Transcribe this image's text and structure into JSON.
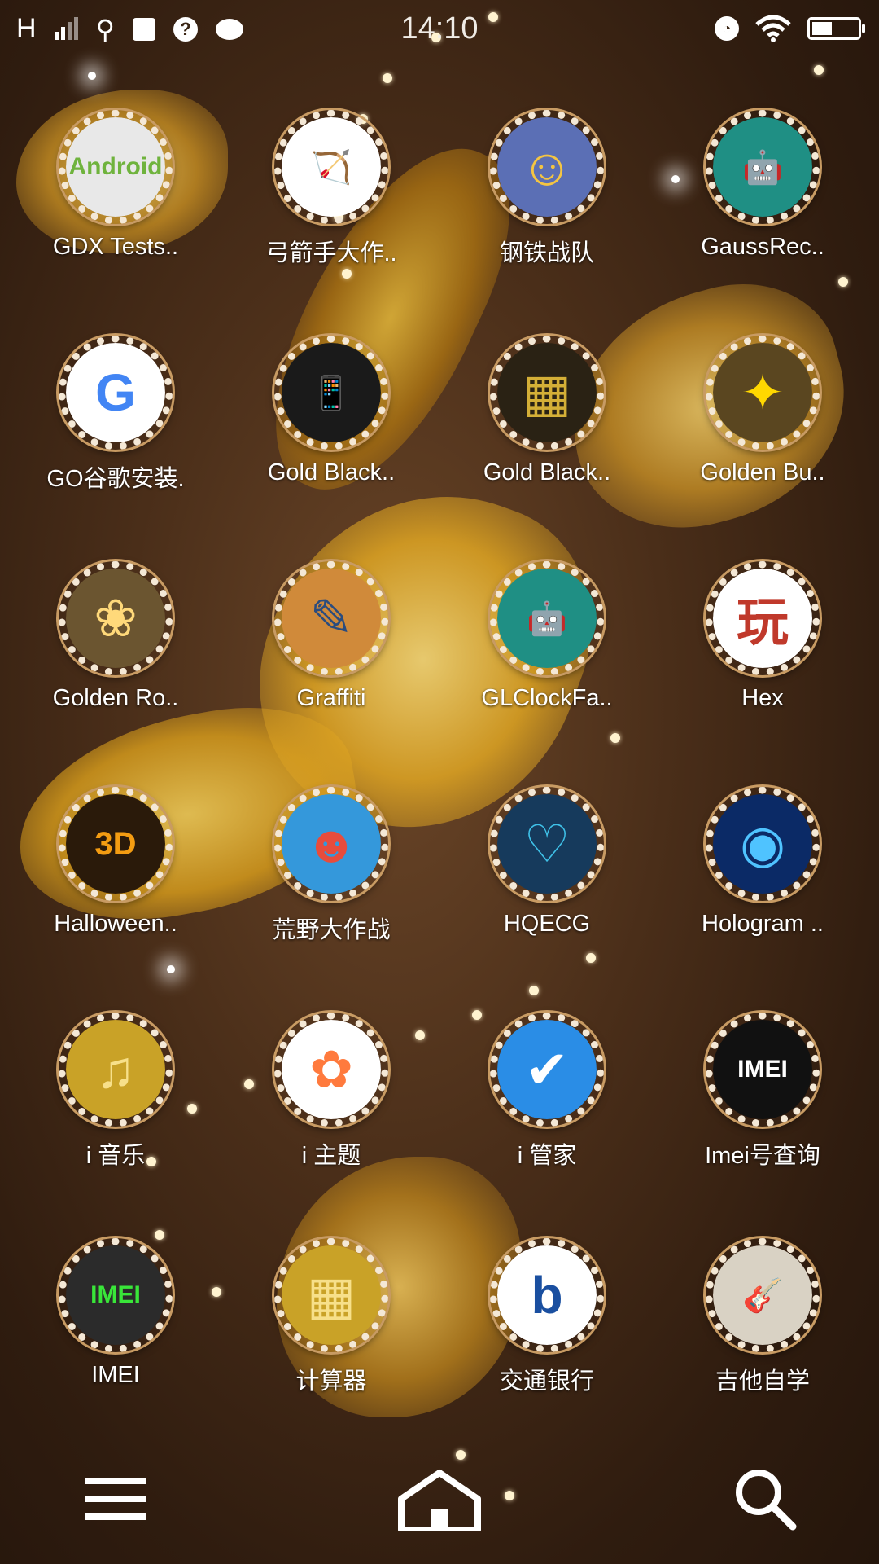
{
  "status_bar": {
    "network": "H",
    "time": "14:10"
  },
  "apps": [
    {
      "label": "GDX Tests..",
      "icon": "android-app-icon",
      "bg": "#e8e8e8",
      "glyph": "Android",
      "fg": "#6fb33d"
    },
    {
      "label": "弓箭手大作..",
      "icon": "bow-arrow-icon",
      "bg": "#ffffff",
      "glyph": "🏹",
      "fg": "#c0392b"
    },
    {
      "label": "钢铁战队",
      "icon": "hero-game-icon",
      "bg": "#5b6fb5",
      "glyph": "☺",
      "fg": "#f4c542"
    },
    {
      "label": "GaussRec..",
      "icon": "android-robot-icon",
      "bg": "#1f8f84",
      "glyph": "🤖",
      "fg": "#ffffff"
    },
    {
      "label": "GO谷歌安装.",
      "icon": "google-go-icon",
      "bg": "#ffffff",
      "glyph": "G",
      "fg": "#4285f4"
    },
    {
      "label": "Gold Black..",
      "icon": "phone-theme-icon",
      "bg": "#1a1a1a",
      "glyph": "📱",
      "fg": "#d4af37"
    },
    {
      "label": "Gold Black..",
      "icon": "gold-theme-icon",
      "bg": "#2a2214",
      "glyph": "▦",
      "fg": "#d4af37"
    },
    {
      "label": "Golden Bu..",
      "icon": "golden-butterfly-icon",
      "bg": "#5a4620",
      "glyph": "✦",
      "fg": "#ffd700"
    },
    {
      "label": "Golden Ro..",
      "icon": "golden-rose-icon",
      "bg": "#6b5530",
      "glyph": "❀",
      "fg": "#ffd97a"
    },
    {
      "label": "Graffiti",
      "icon": "graffiti-icon",
      "bg": "#d08a3a",
      "glyph": "✎",
      "fg": "#2b4c7e"
    },
    {
      "label": "GLClockFa..",
      "icon": "android-robot-icon",
      "bg": "#1f8f84",
      "glyph": "🤖",
      "fg": "#ffffff"
    },
    {
      "label": "Hex",
      "icon": "hex-game-icon",
      "bg": "#ffffff",
      "glyph": "玩",
      "fg": "#c0392b"
    },
    {
      "label": "Halloween..",
      "icon": "halloween-theme-icon",
      "bg": "#2a1a0a",
      "glyph": "3D",
      "fg": "#f39c12"
    },
    {
      "label": "荒野大作战",
      "icon": "wild-battle-game-icon",
      "bg": "#3498db",
      "glyph": "☻",
      "fg": "#e74c3c"
    },
    {
      "label": "HQECG",
      "icon": "heart-ecg-icon",
      "bg": "#163a5c",
      "glyph": "♡",
      "fg": "#3fc1e8"
    },
    {
      "label": "Hologram ..",
      "icon": "hologram-icon",
      "bg": "#0b2a66",
      "glyph": "◉",
      "fg": "#4fc3ff"
    },
    {
      "label": "i 音乐",
      "icon": "music-note-icon",
      "bg": "#c9a227",
      "glyph": "♫",
      "fg": "#f7e08a"
    },
    {
      "label": "i 主题",
      "icon": "theme-pinwheel-icon",
      "bg": "#ffffff",
      "glyph": "✿",
      "fg": "#ff7a3d"
    },
    {
      "label": "i 管家",
      "icon": "shield-check-icon",
      "bg": "#2a8de6",
      "glyph": "✔",
      "fg": "#ffffff"
    },
    {
      "label": "Imei号查询",
      "icon": "imei-query-icon",
      "bg": "#111111",
      "glyph": "IMEI",
      "fg": "#ffffff"
    },
    {
      "label": "IMEI",
      "icon": "imei-icon",
      "bg": "#2b2b2b",
      "glyph": "IMEI",
      "fg": "#39e639"
    },
    {
      "label": "计算器",
      "icon": "calculator-icon",
      "bg": "#c9a227",
      "glyph": "▦",
      "fg": "#f7e08a"
    },
    {
      "label": "交通银行",
      "icon": "bank-logo-icon",
      "bg": "#ffffff",
      "glyph": "b",
      "fg": "#1a4fa0"
    },
    {
      "label": "吉他自学",
      "icon": "guitar-icon",
      "bg": "#d9d2c4",
      "glyph": "🎸",
      "fg": "#5a3a1a"
    }
  ],
  "dock": {
    "menu_icon": "menu-icon",
    "home_icon": "home-icon",
    "search_icon": "search-icon"
  }
}
